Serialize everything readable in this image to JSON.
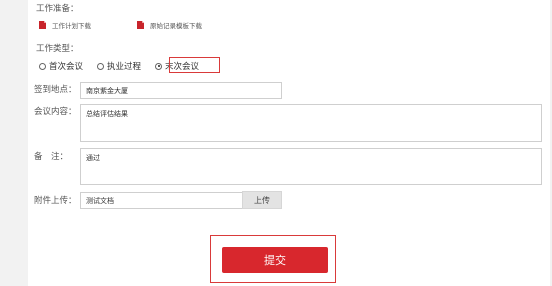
{
  "prep": {
    "label": "工作准备：",
    "downloads": [
      {
        "label": "工作计划下载",
        "icon": "pdf-file-icon"
      },
      {
        "label": "原始记录模板下载",
        "icon": "pdf-file-icon"
      }
    ]
  },
  "work_type": {
    "label": "工作类型：",
    "options": [
      {
        "label": "首次会议",
        "checked": false
      },
      {
        "label": "执业过程",
        "checked": false
      },
      {
        "label": "末次会议",
        "checked": true
      }
    ]
  },
  "location": {
    "label": "签到地点：",
    "value": "南京紫金大厦"
  },
  "meeting": {
    "label": "会议内容：",
    "value": "总结评估结果"
  },
  "remark": {
    "label": "备　注：",
    "value": "通过"
  },
  "attachment": {
    "label": "附件上传：",
    "value": "测试文档",
    "button": "上传"
  },
  "submit": {
    "label": "提交"
  },
  "colors": {
    "accent": "#d8272d",
    "highlight": "#d93a3a",
    "pdf": "#c8242b"
  }
}
